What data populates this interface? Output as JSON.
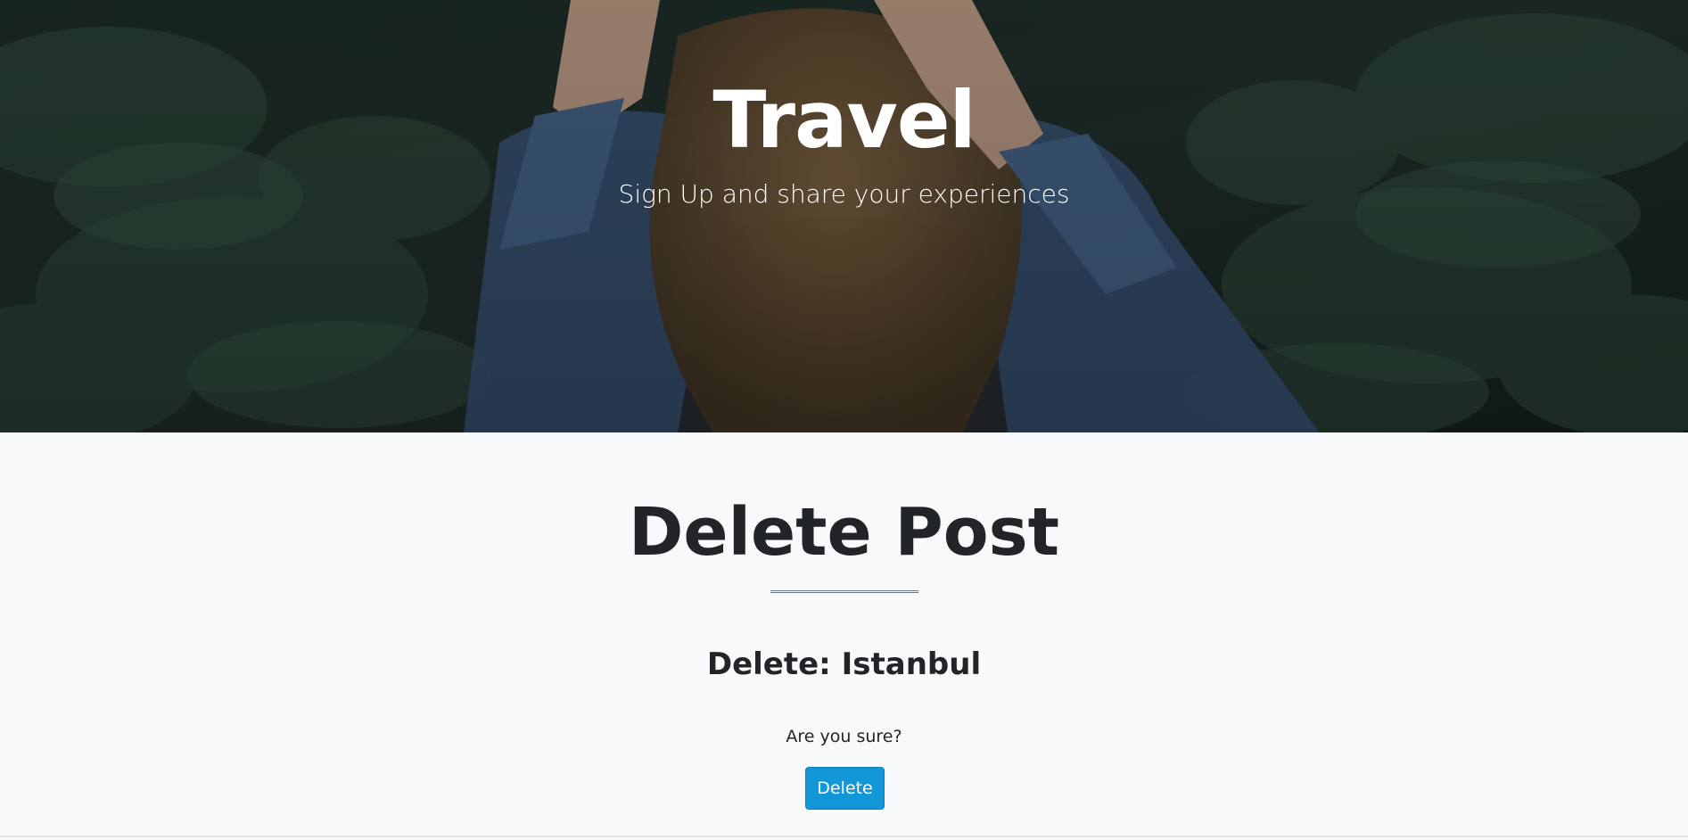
{
  "header": {
    "title": "Travel",
    "subtitle": "Sign Up and share your experiences"
  },
  "main": {
    "title": "Delete Post",
    "post_heading": "Delete: Istanbul",
    "confirm_text": "Are you sure?",
    "delete_button_label": "Delete"
  },
  "colors": {
    "page_background": "#f8f9fa",
    "primary_button": "#1197d8",
    "text": "#212529",
    "hero_overlay": "#1d2e2a"
  }
}
